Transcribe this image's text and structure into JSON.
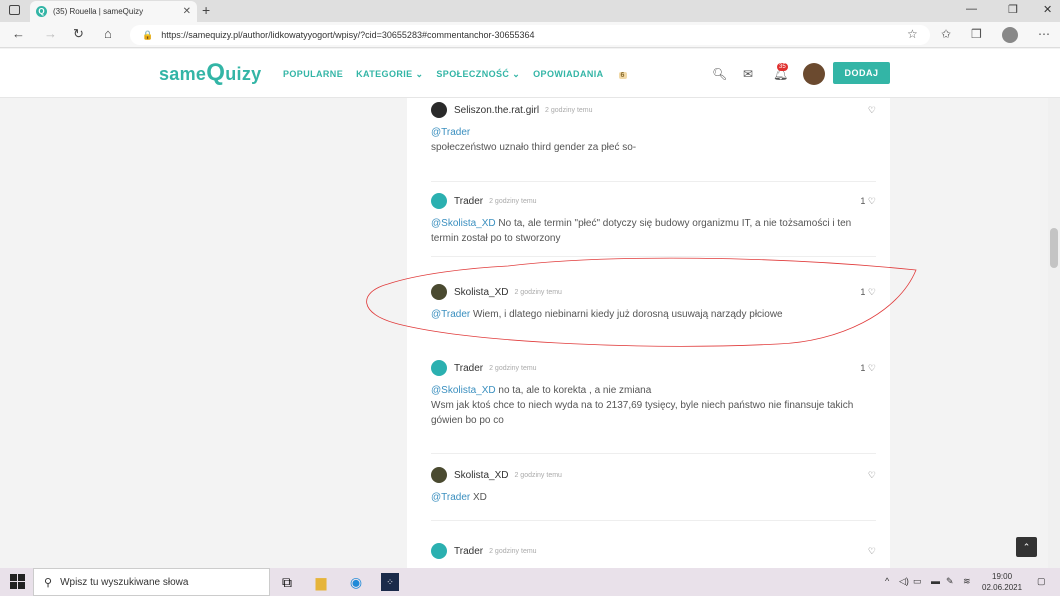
{
  "browser": {
    "tab_title": "(35) Rouella | sameQuizy",
    "tab_favicon": "Q",
    "tab_close": "✕",
    "new_tab": "+",
    "url": "https://samequizy.pl/author/lidkowatyyogort/wpisy/?cid=30655283#commentanchor-30655364",
    "window_controls": [
      "—",
      "❐",
      "✕"
    ]
  },
  "site": {
    "logo_small": "same",
    "logo_big": "Q",
    "logo_rest": "uizy",
    "menu": {
      "popularne": "POPULARNE",
      "kategorie": "KATEGORIE ⌄",
      "spolecznosc": "SPOŁECZNOŚĆ ⌄",
      "opowiadania": "OPOWIADANIA",
      "opowiadania_badge": "6"
    },
    "notification_count": "35",
    "add_button": "DODAJ"
  },
  "comments": [
    {
      "author": "Seliszon.the.rat.girl",
      "time": "2 godziny temu",
      "likes": "",
      "mention": "@Trader",
      "text": "społeczeństwo uznało third gender za płeć so-"
    },
    {
      "author": "Trader",
      "time": "2 godziny temu",
      "likes": "1",
      "mention": "@Skolista_XD",
      "text": " No ta, ale termin \"płeć\" dotyczy się budowy organizmu IT, a nie tożsamości i ten termin został po to stworzony"
    },
    {
      "author": "Skolista_XD",
      "time": "2 godziny temu",
      "likes": "1",
      "mention": "@Trader",
      "text": " Wiem, i dlatego niebinarni kiedy już dorosną usuwają narządy płciowe"
    },
    {
      "author": "Trader",
      "time": "2 godziny temu",
      "likes": "1",
      "mention": "@Skolista_XD",
      "text": " no ta, ale to korekta , a nie zmiana",
      "text2": "Wsm jak ktoś chce to niech wyda na to 2137,69 tysięcy, byle niech państwo nie finansuje takich gówien bo po co"
    },
    {
      "author": "Skolista_XD",
      "time": "2 godziny temu",
      "likes": "",
      "mention": "@Trader",
      "text": " XD"
    },
    {
      "author": "Trader",
      "time": "2 godziny temu",
      "likes": "",
      "mention": "",
      "text": ""
    }
  ],
  "taskbar": {
    "search_placeholder": "Wpisz tu wyszukiwane słowa",
    "time": "19:00",
    "date": "02.06.2021"
  },
  "colors": {
    "brand": "#33b5a6",
    "mention": "#3a8fbf",
    "annotation": "#e03a3a"
  }
}
